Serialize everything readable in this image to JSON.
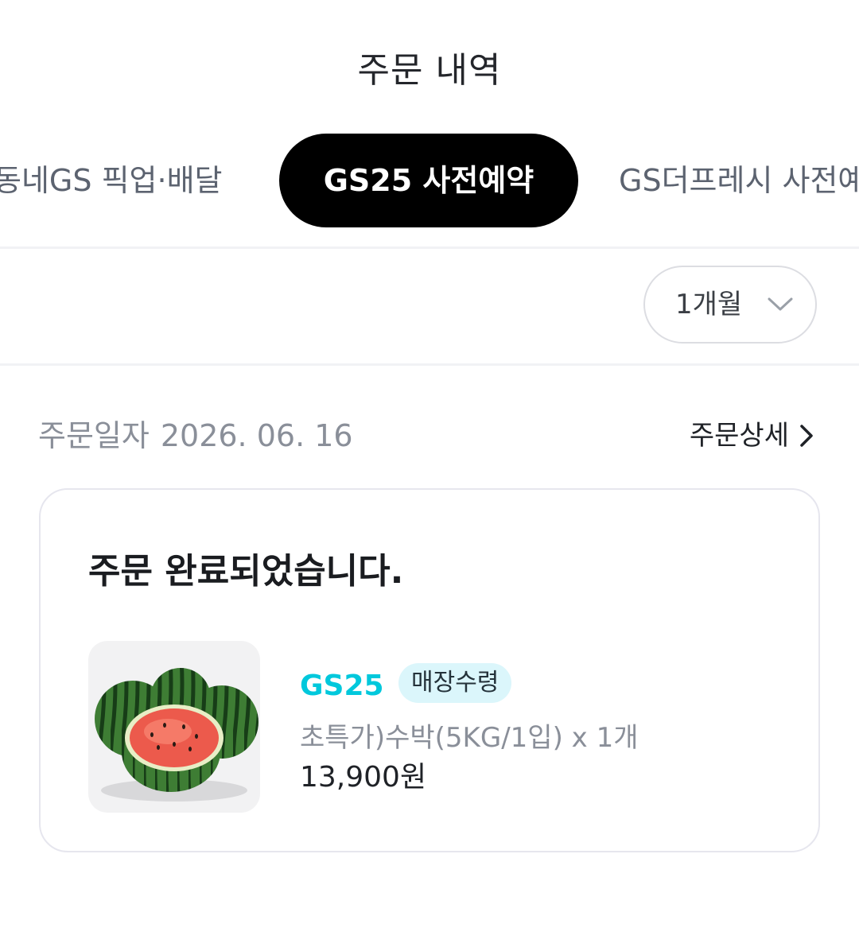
{
  "header": {
    "title": "주문 내역"
  },
  "tabs": [
    {
      "label": "동네GS 픽업·배달",
      "active": false
    },
    {
      "label": "GS25 사전예약",
      "active": true
    },
    {
      "label": "GS더프레시 사전예약",
      "active": false
    }
  ],
  "filter": {
    "period_value": "1개월",
    "icon": "chevron-down-icon"
  },
  "order": {
    "date_prefix": "주문일자",
    "date": "2026. 06. 16",
    "detail_link": "주문상세",
    "status": "주문 완료되었습니다.",
    "item": {
      "image": "watermelon-image",
      "store": "GS25",
      "badge": "매장수령",
      "name": "초특가)수박(5KG/1입) x 1개",
      "price": "13,900원"
    }
  },
  "colors": {
    "active_tab_bg": "#000000",
    "store_accent": "#00c8dc",
    "badge_bg": "#dbf6fb",
    "muted_text": "#8a8f99"
  }
}
